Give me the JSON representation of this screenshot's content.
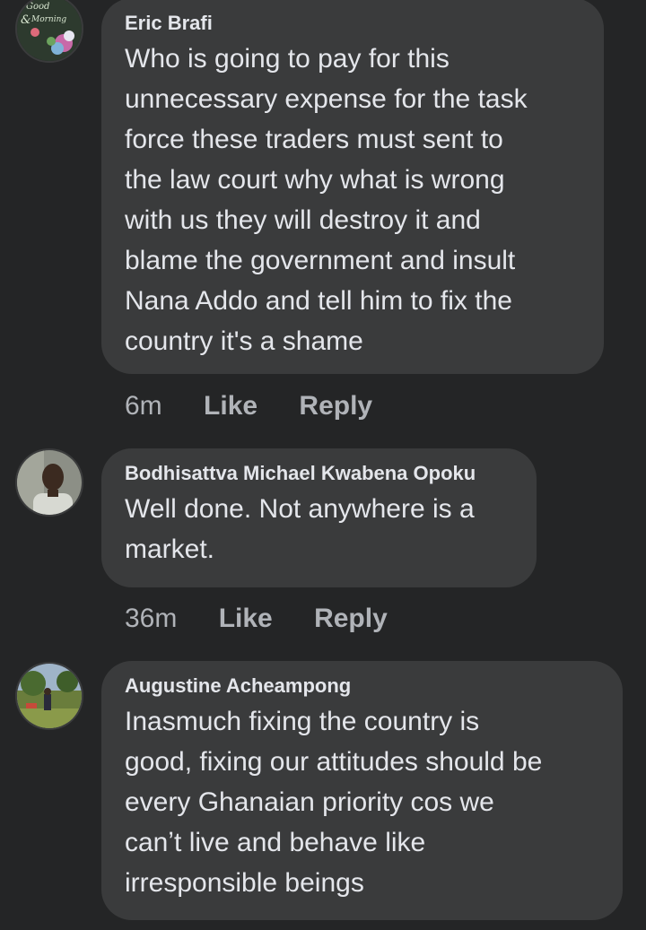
{
  "comments": [
    {
      "author": "Eric Brafi",
      "avatar_icon": "good-morning-flowers-avatar",
      "avatar_caption": "Good & Morning",
      "text": "Who is going to pay for this\nunnecessary expense for the task\nforce these traders must sent to\nthe law court why what is wrong\nwith us they will destroy it and\nblame the government and insult\nNana Addo and tell him to fix the\ncountry it's a shame",
      "time": "6m",
      "like_label": "Like",
      "reply_label": "Reply"
    },
    {
      "author": "Bodhisattva Michael Kwabena Opoku",
      "avatar_icon": "man-portrait-avatar",
      "text": "Well done. Not anywhere is a\nmarket.",
      "time": "36m",
      "like_label": "Like",
      "reply_label": "Reply"
    },
    {
      "author": "Augustine Acheampong",
      "avatar_icon": "outdoor-landscape-avatar",
      "text": "Inasmuch fixing the country is\ngood, fixing our attitudes should be\nevery Ghanaian priority cos we\ncanʼt live and behave like\nirresponsible beings",
      "time": "",
      "like_label": "",
      "reply_label": ""
    }
  ],
  "colors": {
    "background": "#242526",
    "bubble": "#3a3b3c",
    "text": "#e4e6eb",
    "meta": "#b0b3b8"
  }
}
